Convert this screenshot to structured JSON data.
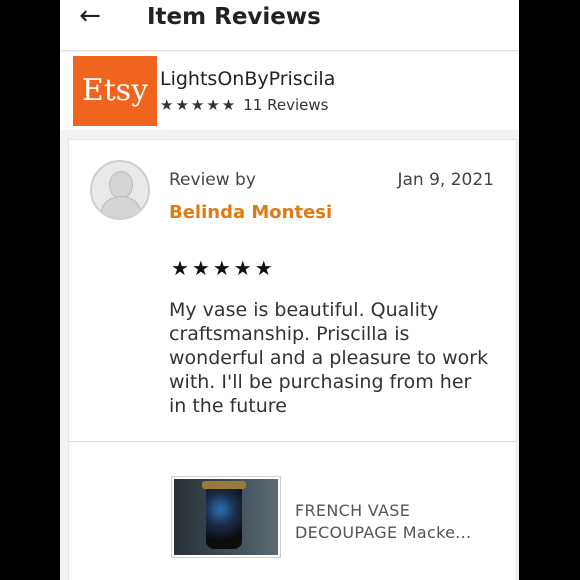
{
  "header": {
    "back_icon": "arrow-left-icon",
    "back_glyph": "←",
    "title": "Item Reviews"
  },
  "shop": {
    "logo_text": "Etsy",
    "logo_color": "#f1641e",
    "name": "LightsOnByPriscila",
    "stars": "★★★★★",
    "review_count": "11 Reviews"
  },
  "review": {
    "label": "Review by",
    "date": "Jan 9, 2021",
    "reviewer": "Belinda Montesi",
    "reviewer_color": "#e07a12",
    "stars": "★★★★★",
    "text": "My vase is beautiful. Quality craftsmanship. Priscilla is wonderful and a pleasure to work with. I'll be purchasing from her in the future"
  },
  "item": {
    "title": "FRENCH VASE DECOUPAGE Macke..."
  }
}
